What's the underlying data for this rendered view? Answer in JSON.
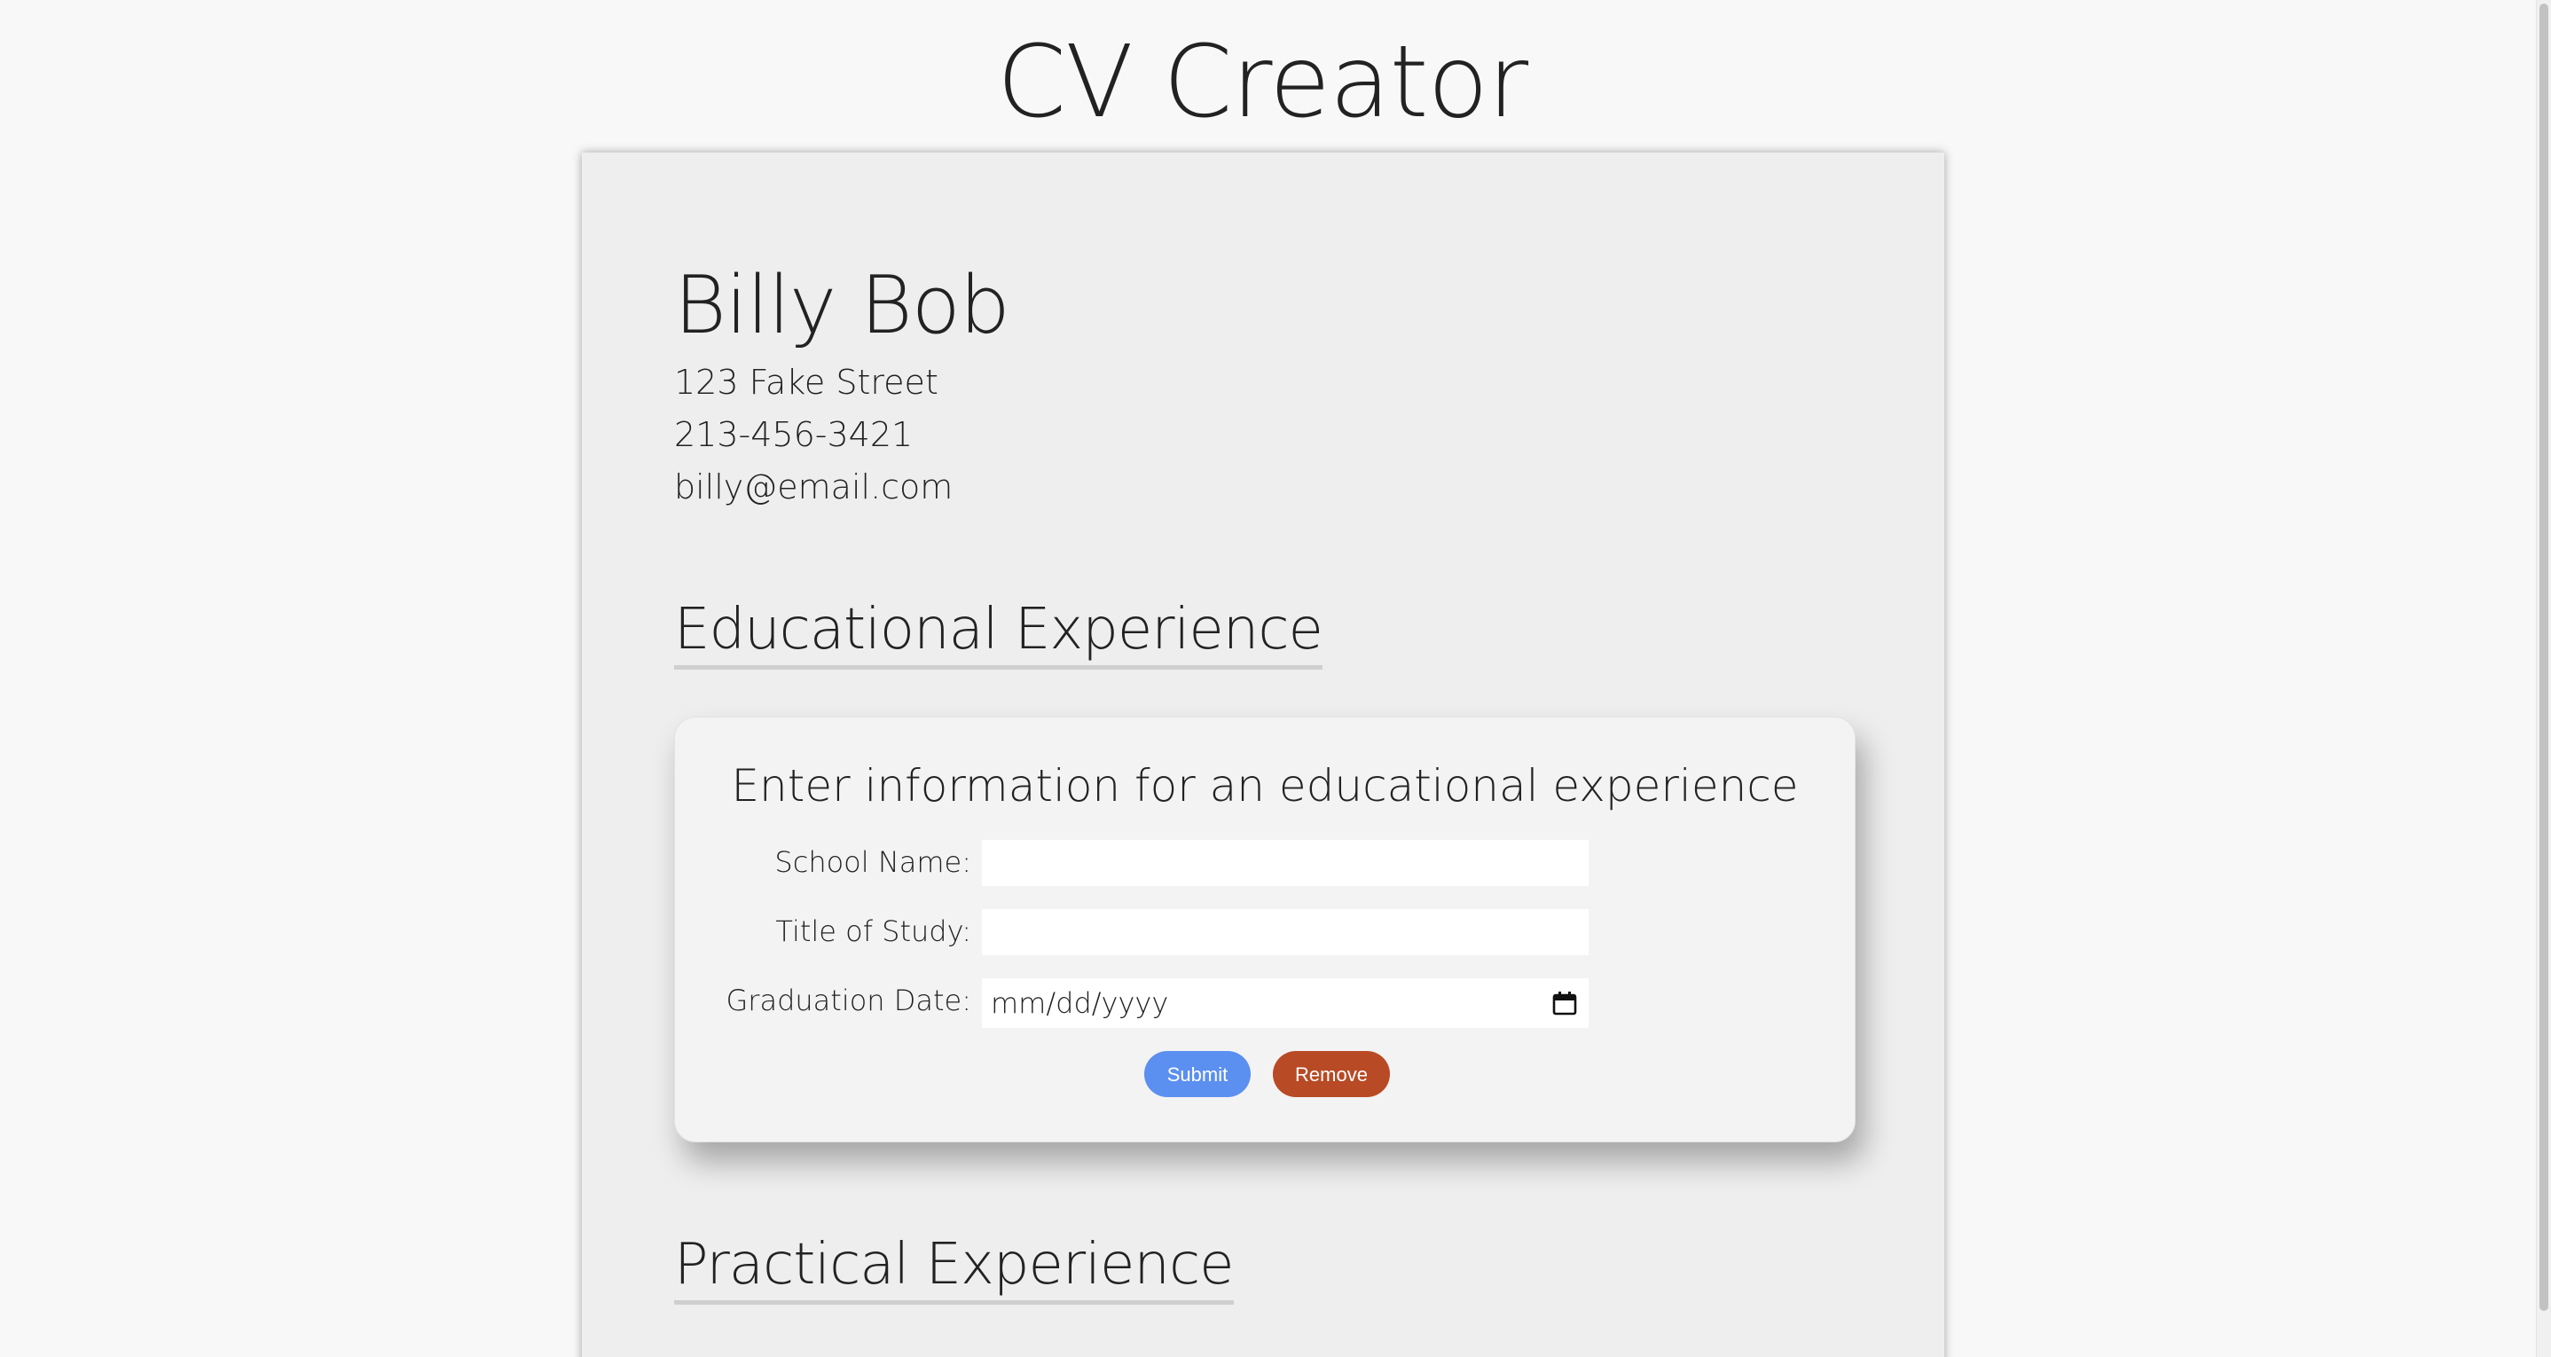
{
  "app": {
    "title": "CV Creator"
  },
  "personal": {
    "name": "Billy Bob",
    "address": "123 Fake Street",
    "phone": "213-456-3421",
    "email": "billy@email.com"
  },
  "sections": {
    "educational_heading": "Educational Experience",
    "practical_heading": "Practical Experience"
  },
  "education_form": {
    "heading": "Enter information for an educational experience",
    "school_label": "School Name:",
    "school_value": "",
    "title_label": "Title of Study:",
    "title_value": "",
    "graduation_label": "Graduation Date:",
    "graduation_placeholder": "mm/dd/yyyy",
    "submit_label": "Submit",
    "remove_label": "Remove"
  },
  "icons": {
    "date_picker": "calendar-icon"
  },
  "colors": {
    "page_background": "#f8f8f8",
    "sheet_background": "#eeeeee",
    "submit_button": "#5b8ff0",
    "remove_button": "#b84a25",
    "text": "#222222"
  }
}
